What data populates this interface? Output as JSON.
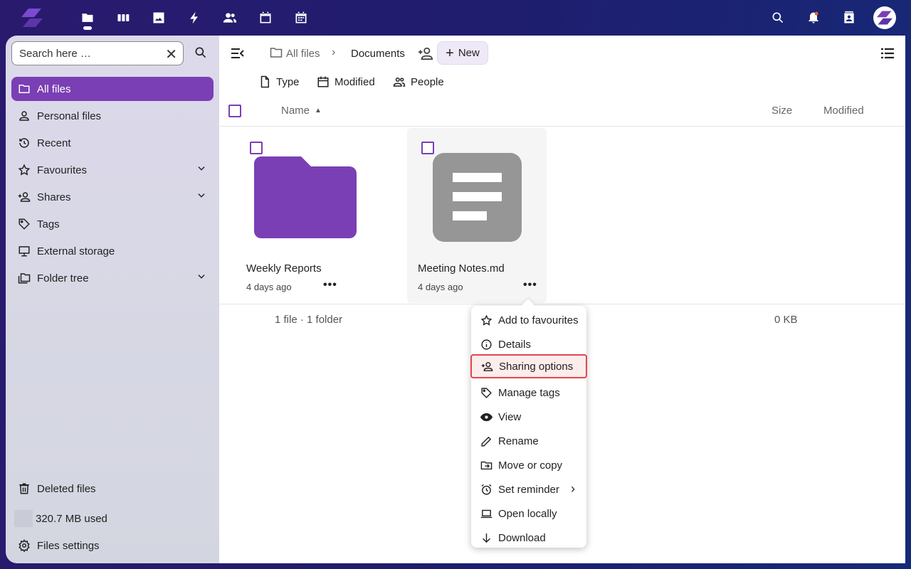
{
  "topbar": {
    "apps": [
      "files-icon",
      "deck-icon",
      "photos-icon",
      "activity-icon",
      "contacts-icon",
      "calendar-icon",
      "calendar-grid-icon"
    ],
    "right": [
      "search-icon",
      "notifications-icon",
      "contacts-menu-icon",
      "avatar"
    ],
    "notification_color": "#e9642f"
  },
  "sidebar": {
    "search_placeholder": "Search here …",
    "items": [
      {
        "label": "All files",
        "icon": "folder-icon",
        "active": true
      },
      {
        "label": "Personal files",
        "icon": "person-icon"
      },
      {
        "label": "Recent",
        "icon": "history-icon"
      },
      {
        "label": "Favourites",
        "icon": "star-icon",
        "expandable": true
      },
      {
        "label": "Shares",
        "icon": "share-icon",
        "expandable": true
      },
      {
        "label": "Tags",
        "icon": "tag-icon"
      },
      {
        "label": "External storage",
        "icon": "monitor-icon"
      },
      {
        "label": "Folder tree",
        "icon": "folder-multiple-icon",
        "expandable": true
      }
    ],
    "deleted": "Deleted files",
    "quota": "320.7 MB used",
    "settings": "Files settings"
  },
  "breadcrumb": {
    "root": "All files",
    "current": "Documents"
  },
  "new_label": "New",
  "filters": {
    "type": "Type",
    "modified": "Modified",
    "people": "People"
  },
  "columns": {
    "name": "Name",
    "size": "Size",
    "modified": "Modified"
  },
  "files": [
    {
      "name": "Weekly Reports",
      "date": "4 days ago",
      "kind": "folder",
      "color": "#7b3fb5"
    },
    {
      "name": "Meeting Notes.md",
      "date": "4 days ago",
      "kind": "document",
      "color": "#969696"
    }
  ],
  "summary": {
    "counts": "1 file · 1 folder",
    "size": "0 KB"
  },
  "menu": [
    {
      "label": "Add to favourites",
      "icon": "star-icon"
    },
    {
      "label": "Details",
      "icon": "info-icon"
    },
    {
      "label": "Sharing options",
      "icon": "share-icon",
      "highlighted": true
    },
    {
      "label": "Manage tags",
      "icon": "tag-icon"
    },
    {
      "label": "View",
      "icon": "eye-icon"
    },
    {
      "label": "Rename",
      "icon": "pencil-icon"
    },
    {
      "label": "Move or copy",
      "icon": "folder-move-icon"
    },
    {
      "label": "Set reminder",
      "icon": "alarm-icon",
      "submenu": true
    },
    {
      "label": "Open locally",
      "icon": "laptop-icon"
    },
    {
      "label": "Download",
      "icon": "download-icon"
    }
  ]
}
